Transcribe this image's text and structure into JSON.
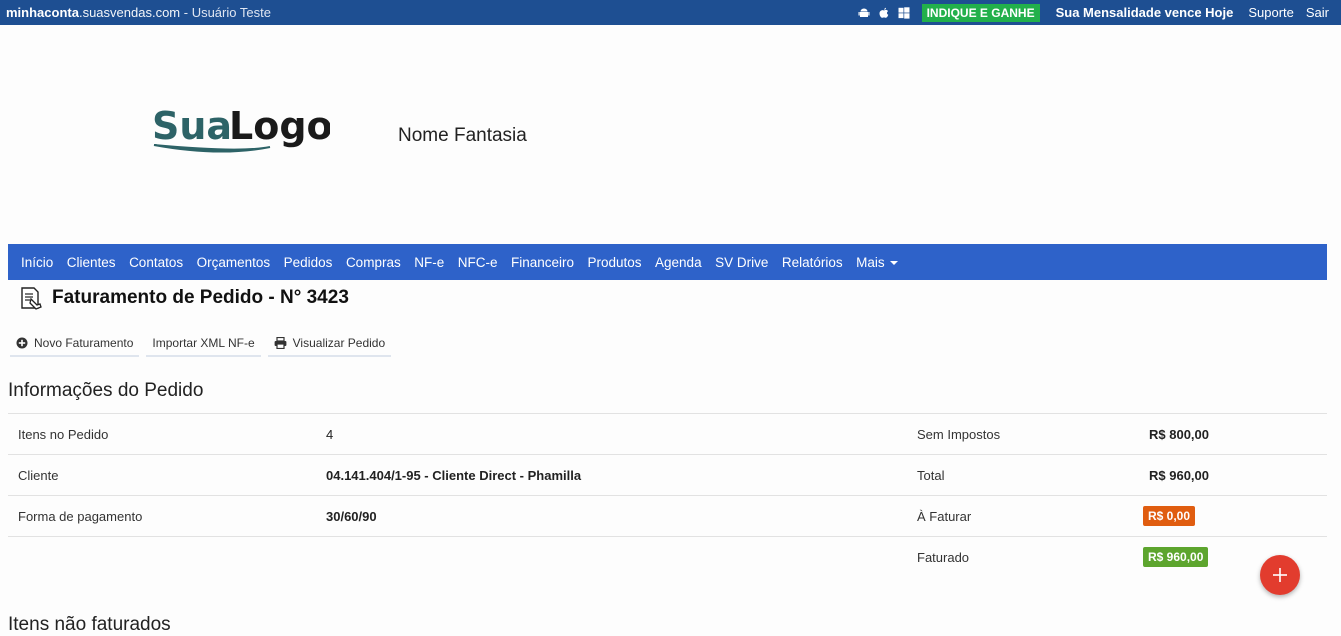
{
  "topbar": {
    "site_bold": "minhaconta",
    "site_domain": ".suasvendas.com",
    "user": " - Usuário Teste",
    "indique": "INDIQUE E GANHE",
    "mensalidade": "Sua Mensalidade vence Hoje",
    "suporte": "Suporte",
    "sair": "Sair"
  },
  "header": {
    "logo_text_a": "Sua",
    "logo_text_b": "Logo",
    "fantasia": "Nome Fantasia"
  },
  "nav": {
    "items": [
      "Início",
      "Clientes",
      "Contatos",
      "Orçamentos",
      "Pedidos",
      "Compras",
      "NF-e",
      "NFC-e",
      "Financeiro",
      "Produtos",
      "Agenda",
      "SV Drive",
      "Relatórios"
    ],
    "more": "Mais"
  },
  "page": {
    "title": "Faturamento de Pedido - N° 3423"
  },
  "actions": {
    "novo": "Novo Faturamento",
    "importar": "Importar XML NF-e",
    "visualizar": "Visualizar Pedido"
  },
  "info": {
    "heading": "Informações do Pedido",
    "itens_label": "Itens no Pedido",
    "itens_value": "4",
    "cliente_label": "Cliente",
    "cliente_value": "04.141.404/1-95 - Cliente Direct - Phamilla",
    "pagamento_label": "Forma de pagamento",
    "pagamento_value": "30/60/90",
    "sem_impostos_label": "Sem Impostos",
    "sem_impostos_value": "R$ 800,00",
    "total_label": "Total",
    "total_value": "R$ 960,00",
    "a_faturar_label": "À Faturar",
    "a_faturar_value": "R$ 0,00",
    "faturado_label": "Faturado",
    "faturado_value": "R$ 960,00"
  },
  "section2": {
    "heading": "Itens não faturados"
  },
  "colors": {
    "topbar": "#1e4f92",
    "nav": "#2e62c9",
    "indique": "#22b04b",
    "orange_badge": "#e05d10",
    "green_badge": "#5da52e",
    "fab": "#e23c2e"
  }
}
